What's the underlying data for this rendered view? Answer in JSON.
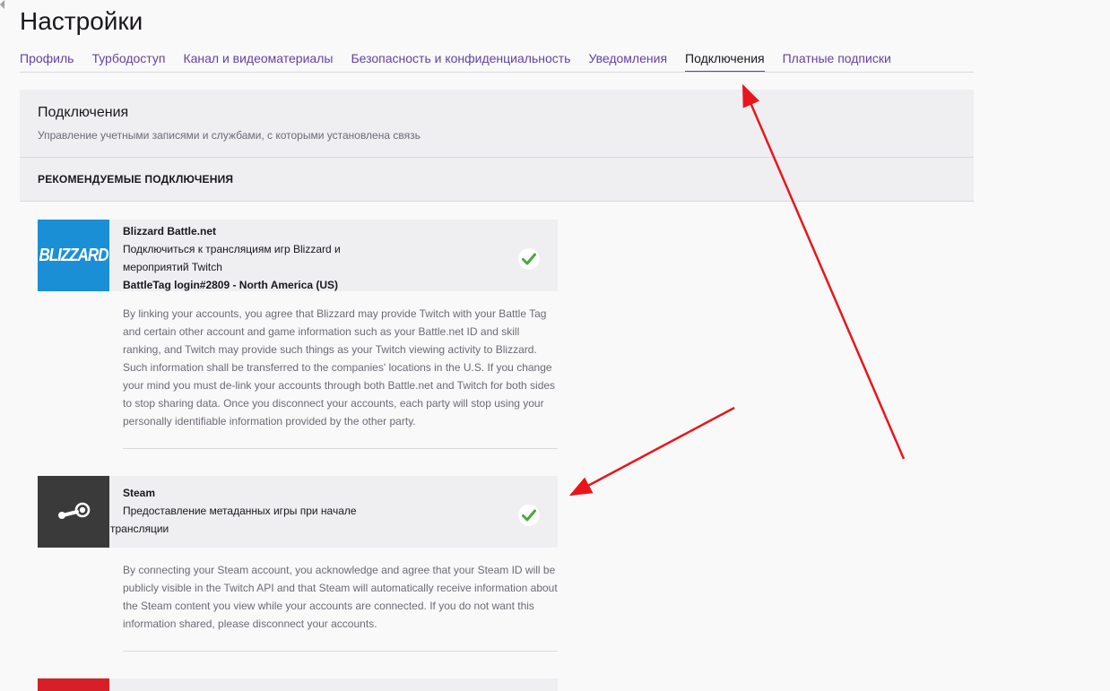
{
  "page": {
    "title": "Настройки"
  },
  "tabs": [
    {
      "label": "Профиль",
      "active": false
    },
    {
      "label": "Турбодоступ",
      "active": false
    },
    {
      "label": "Канал и видеоматериалы",
      "active": false
    },
    {
      "label": "Безопасность и конфиденциальность",
      "active": false
    },
    {
      "label": "Уведомления",
      "active": false
    },
    {
      "label": "Подключения",
      "active": true
    },
    {
      "label": "Платные подписки",
      "active": false
    }
  ],
  "connections_panel": {
    "title": "Подключения",
    "subtitle": "Управление учетными записями и службами, с которыми установлена связь",
    "section_title": "РЕКОМЕНДУЕМЫЕ ПОДКЛЮЧЕНИЯ"
  },
  "connections": [
    {
      "logo_text": "BLIZZARD",
      "logo_icon": "blizzard-logo",
      "name": "Blizzard Battle.net",
      "description_line1": "Подключиться к трансляциям игр Blizzard и",
      "description_line2": "мероприятий Twitch",
      "account": "BattleTag login#2809 - North America (US)",
      "status_icon": "check-icon",
      "legal_text": "By linking your accounts, you agree that Blizzard may provide Twitch with your Battle Tag and certain other account and game information such as your Battle.net ID and skill ranking, and Twitch may provide such things as your Twitch viewing activity to Blizzard. Such information shall be transferred to the companies' locations in the U.S. If you change your mind you must de-link your accounts through both Battle.net and Twitch for both sides to stop sharing data. Once you disconnect your accounts, each party will stop using your personally identifiable information provided by the other party."
    },
    {
      "logo_icon": "steam-logo",
      "name": "Steam",
      "description_line1": "Предоставление метаданных игры при начале",
      "description_line2": "трансляции",
      "status_icon": "check-icon",
      "legal_text": "By connecting your Steam account, you acknowledge and agree that your Steam ID will be publicly visible in the Twitch API and that Steam will automatically receive information about the Steam content you view while your accounts are connected. If you do not want this information shared, please disconnect your accounts."
    }
  ],
  "colors": {
    "accent": "#6441a4",
    "check": "#4ca543",
    "blizzard": "#1a8fd6",
    "steam": "#3a3a3a",
    "annotation": "#e8161b"
  }
}
